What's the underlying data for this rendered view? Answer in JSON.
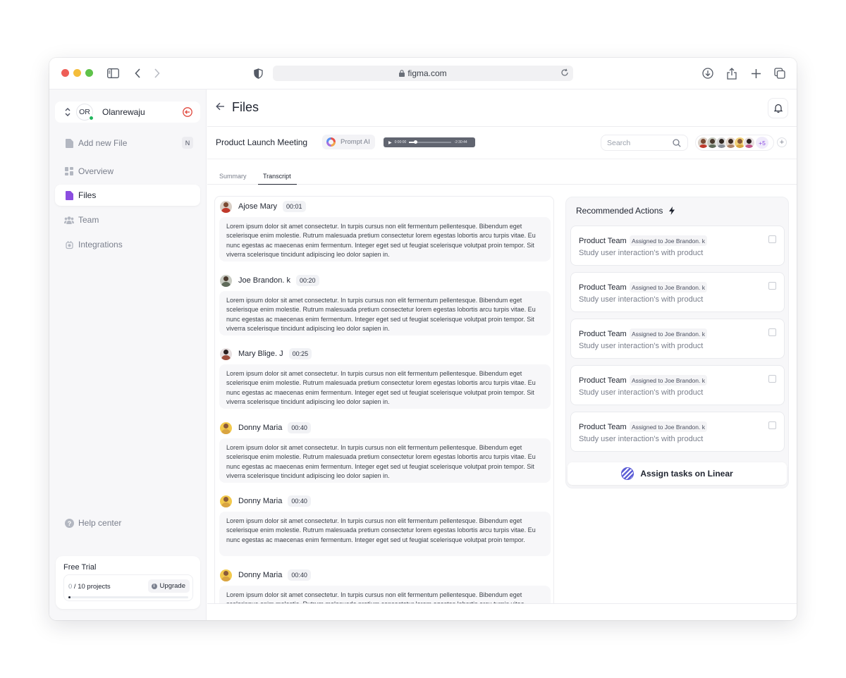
{
  "browser": {
    "url": "figma.com"
  },
  "sidebar": {
    "user": {
      "initials": "OR",
      "name": "Olanrewaju"
    },
    "items": [
      {
        "label": "Add new File",
        "shortcut": "N",
        "icon": "file-icon"
      },
      {
        "label": "Overview",
        "icon": "grid-icon"
      },
      {
        "label": "Files",
        "icon": "file-icon",
        "active": true
      },
      {
        "label": "Team",
        "icon": "team-icon"
      },
      {
        "label": "Integrations",
        "icon": "plug-icon"
      },
      {
        "label": "Help center",
        "icon": "help-icon"
      }
    ],
    "trial": {
      "title": "Free Trial",
      "used": "0",
      "total": " / 10 projects",
      "upgrade": "Upgrade",
      "progress": 0.02
    }
  },
  "header": {
    "title": "Files"
  },
  "meeting": {
    "title": "Product Launch Meeting",
    "prompt_ai": "Prompt AI",
    "audio_current": "0:00:00",
    "audio_remaining": "-2:30:44",
    "search_placeholder": "Search",
    "participants_more": "+5",
    "add": "+"
  },
  "tabs": [
    {
      "label": "Summary",
      "active": false
    },
    {
      "label": "Transcript",
      "active": true
    }
  ],
  "transcript": [
    {
      "name": "Ajose Mary",
      "time": "00:01",
      "text": "Lorem ipsum dolor sit amet consectetur. In turpis cursus non elit fermentum pellentesque. Bibendum eget scelerisque enim molestie. Rutrum malesuada pretium consectetur lorem egestas lobortis arcu turpis vitae. Eu nunc egestas ac maecenas enim fermentum. Integer eget sed ut feugiat scelerisque volutpat proin tempor. Sit viverra scelerisque tincidunt adipiscing leo dolor sapien in."
    },
    {
      "name": "Joe Brandon. k",
      "time": "00:20",
      "text": "Lorem ipsum dolor sit amet consectetur. In turpis cursus non elit fermentum pellentesque. Bibendum eget scelerisque enim molestie. Rutrum malesuada pretium consectetur lorem egestas lobortis arcu turpis vitae. Eu nunc egestas ac maecenas enim fermentum. Integer eget sed ut feugiat scelerisque volutpat proin tempor. Sit viverra scelerisque tincidunt adipiscing leo dolor sapien in."
    },
    {
      "name": "Mary Blige. J",
      "time": "00:25",
      "text": "Lorem ipsum dolor sit amet consectetur. In turpis cursus non elit fermentum pellentesque. Bibendum eget scelerisque enim molestie. Rutrum malesuada pretium consectetur lorem egestas lobortis arcu turpis vitae. Eu nunc egestas ac maecenas enim fermentum. Integer eget sed ut feugiat scelerisque volutpat proin tempor. Sit viverra scelerisque tincidunt adipiscing leo dolor sapien in."
    },
    {
      "name": "Donny Maria",
      "time": "00:40",
      "text": "Lorem ipsum dolor sit amet consectetur. In turpis cursus non elit fermentum pellentesque. Bibendum eget scelerisque enim molestie. Rutrum malesuada pretium consectetur lorem egestas lobortis arcu turpis vitae. Eu nunc egestas ac maecenas enim fermentum. Integer eget sed ut feugiat scelerisque volutpat proin tempor. Sit viverra scelerisque tincidunt adipiscing leo dolor sapien in."
    },
    {
      "name": "Donny Maria",
      "time": "00:40",
      "text": "Lorem ipsum dolor sit amet consectetur. In turpis cursus non elit fermentum pellentesque. Bibendum eget scelerisque enim molestie. Rutrum malesuada pretium consectetur lorem egestas lobortis arcu turpis vitae. Eu nunc egestas ac maecenas enim fermentum. Integer eget sed ut feugiat scelerisque volutpat proin tempor."
    },
    {
      "name": "Donny Maria",
      "time": "00:40",
      "text": "Lorem ipsum dolor sit amet consectetur. In turpis cursus non elit fermentum pellentesque. Bibendum eget scelerisque enim molestie. Rutrum malesuada pretium consectetur lorem egestas lobortis arcu turpis vitae."
    }
  ],
  "recommended": {
    "title": "Recommended Actions",
    "tasks": [
      {
        "team": "Product Team",
        "assigned": "Assigned to Joe Brandon. k",
        "desc": "Study user interaction's with product"
      },
      {
        "team": "Product Team",
        "assigned": "Assigned to Joe Brandon. k",
        "desc": "Study user interaction's with product"
      },
      {
        "team": "Product Team",
        "assigned": "Assigned to Joe Brandon. k",
        "desc": "Study user interaction's with product"
      },
      {
        "team": "Product Team",
        "assigned": "Assigned to Joe Brandon. k",
        "desc": "Study user interaction's with product"
      },
      {
        "team": "Product Team",
        "assigned": "Assigned to Joe Brandon. k",
        "desc": "Study user interaction's with product"
      }
    ],
    "linear_button": "Assign tasks on Linear"
  },
  "colors": {
    "accent": "#8b4de0",
    "logout": "#e0473c",
    "online": "#22b55d",
    "linear": "#5e5fd7"
  }
}
